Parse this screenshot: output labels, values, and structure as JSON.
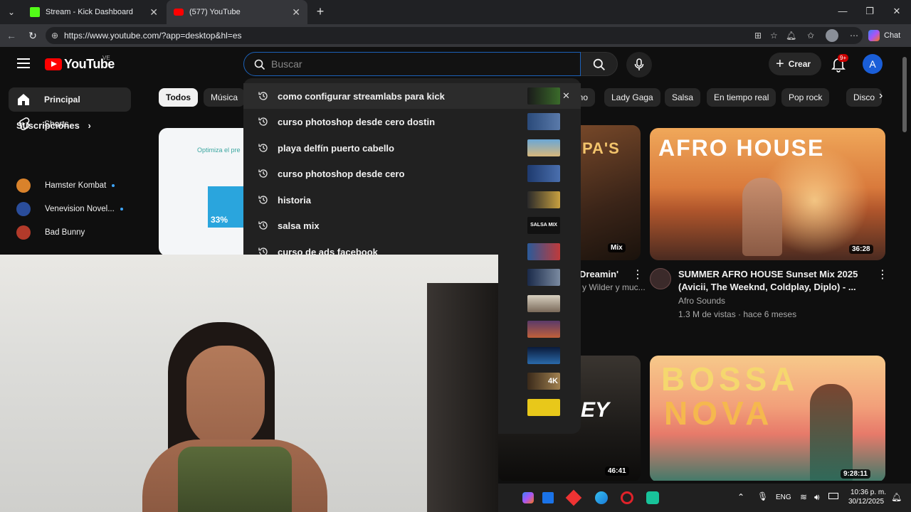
{
  "browser": {
    "tabs": [
      {
        "title": "Stream - Kick Dashboard"
      },
      {
        "title": "(577) YouTube"
      }
    ],
    "url": "https://www.youtube.com/?app=desktop&hl=es",
    "chat_label": "Chat"
  },
  "youtube": {
    "logo_text": "YouTube",
    "country_code": "VE",
    "search_placeholder": "Buscar",
    "create_label": "Crear",
    "notification_badge": "9+",
    "avatar_letter": "A",
    "sidebar": {
      "items": [
        {
          "label": "Principal"
        },
        {
          "label": "Shorts"
        }
      ],
      "subscriptions_heading": "Suscripciones",
      "subscriptions": [
        {
          "name": "Hamster Kombat",
          "color": "#d9822b"
        },
        {
          "name": "Venevision Novel...",
          "color": "#2a4d9b"
        },
        {
          "name": "Bad Bunny",
          "color": "#b23a2a"
        }
      ]
    },
    "chips": [
      "Todos",
      "Música",
      "ino",
      "Lady Gaga",
      "Salsa",
      "En tiempo real",
      "Pop rock",
      "Disco"
    ],
    "ad_card": {
      "text": "Optimiza el pre",
      "percent": "33%"
    },
    "suggestions": [
      {
        "text": "como configurar streamlabs para kick"
      },
      {
        "text": "curso photoshop desde cero dostin"
      },
      {
        "text": "playa delfín puerto cabello"
      },
      {
        "text": "curso photoshop desde cero"
      },
      {
        "text": "historia"
      },
      {
        "text": "salsa mix"
      },
      {
        "text": "curso de ads facebook"
      }
    ],
    "suggestion_thumb_labels": {
      "salsa": "SALSA MIX",
      "k4": "4K"
    },
    "videos": [
      {
        "title_line1": "Dreamin'",
        "channel": "y Wilder y muc...",
        "overlay_label": "Mix"
      },
      {
        "title_line1": "SUMMER AFRO HOUSE Sunset Mix 2025",
        "title_line2": "(Avicii, The Weeknd, Coldplay, Diplo) - ...",
        "channel": "Afro Sounds",
        "meta": "1.3 M de vistas · hace 6 meses",
        "duration": "36:28",
        "thumb_text": "AFRO HOUSE"
      },
      {
        "thumb_text": "EY",
        "duration": "46:41"
      },
      {
        "thumb_text_1": "BOSSA",
        "thumb_text_2": "NOVA",
        "duration": "9:28:11"
      }
    ]
  },
  "taskbar": {
    "language": "ENG",
    "time": "10:36 p. m.",
    "date": "30/12/2025"
  }
}
